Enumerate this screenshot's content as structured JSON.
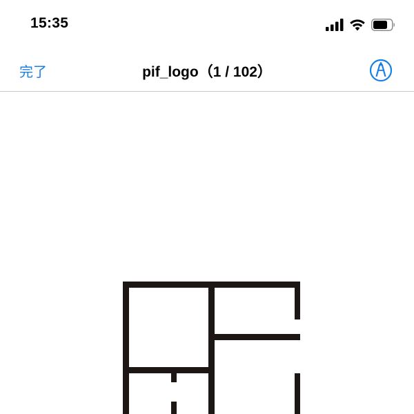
{
  "status_bar": {
    "time": "15:35",
    "icons": [
      "cellular-signal-icon",
      "wifi-icon",
      "battery-icon"
    ]
  },
  "nav_bar": {
    "done_label": "完了",
    "title": "pif_logo（1 / 102）",
    "markup_icon": "markup-pen-icon"
  },
  "colors": {
    "accent": "#1a7fe3",
    "logo_stroke": "#1c1714",
    "separator": "#c8c7cc"
  }
}
